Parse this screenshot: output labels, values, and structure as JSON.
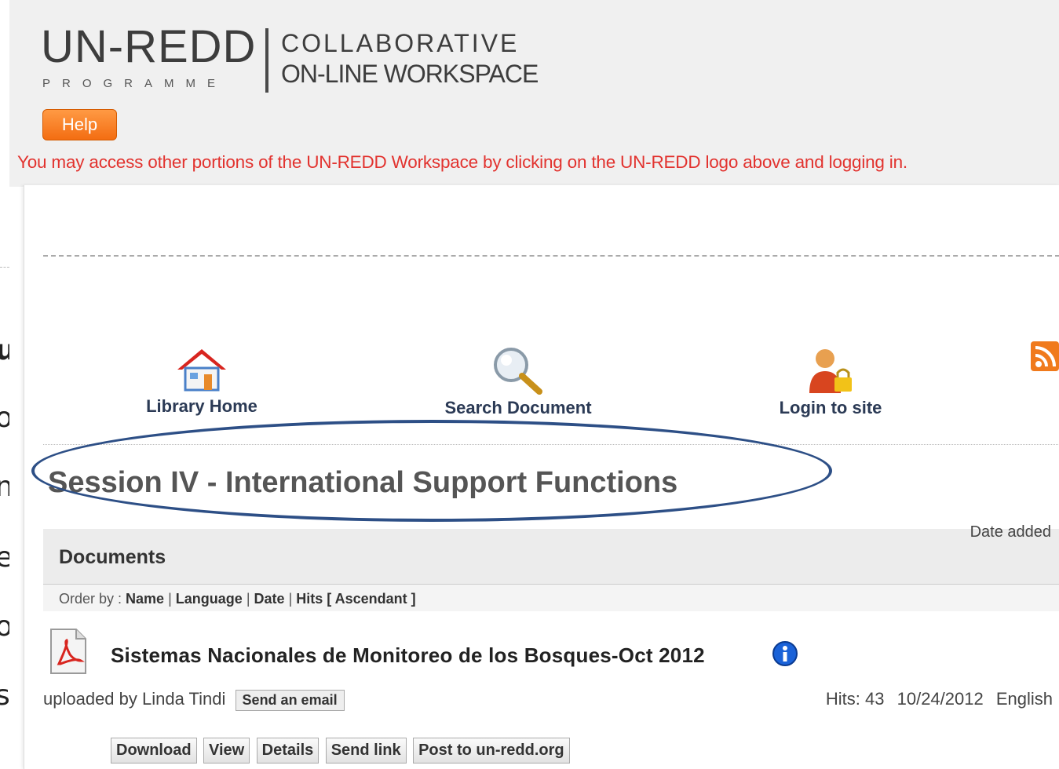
{
  "left_fragments": [
    "u",
    "o",
    "n",
    "e",
    "o",
    "s"
  ],
  "header": {
    "logo_main": "UN-REDD",
    "logo_sub": "PROGRAMME",
    "logo_line1": "COLLABORATIVE",
    "logo_line2": "ON-LINE WORKSPACE",
    "help_label": "Help",
    "notice": "You may access other portions of the UN-REDD Workspace by clicking on the UN-REDD logo above and logging in."
  },
  "nav": {
    "library_home": "Library Home",
    "search_document": "Search Document",
    "login": "Login to site"
  },
  "page_title": "Session IV - International Support Functions",
  "date_added_label": "Date added",
  "documents": {
    "title": "Documents",
    "order_prefix": "Order by :",
    "order_name": "Name",
    "order_language": "Language",
    "order_date": "Date",
    "order_hits": "Hits",
    "order_dir": "[ Ascendant ]"
  },
  "doc": {
    "title": "Sistemas Nacionales de Monitoreo de los Bosques-Oct 2012",
    "uploaded_by": "uploaded by Linda Tindi",
    "send_email": "Send an email",
    "hits": "Hits: 43",
    "date": "10/24/2012",
    "language": "English"
  },
  "actions": {
    "download": "Download",
    "view": "View",
    "details": "Details",
    "send_link": "Send link",
    "post": "Post to un-redd.org"
  },
  "colors": {
    "notice": "#e2332f",
    "help_button": "#f36d12",
    "highlight_ellipse": "#2d4f86",
    "header_bg": "#f0f0f0"
  }
}
